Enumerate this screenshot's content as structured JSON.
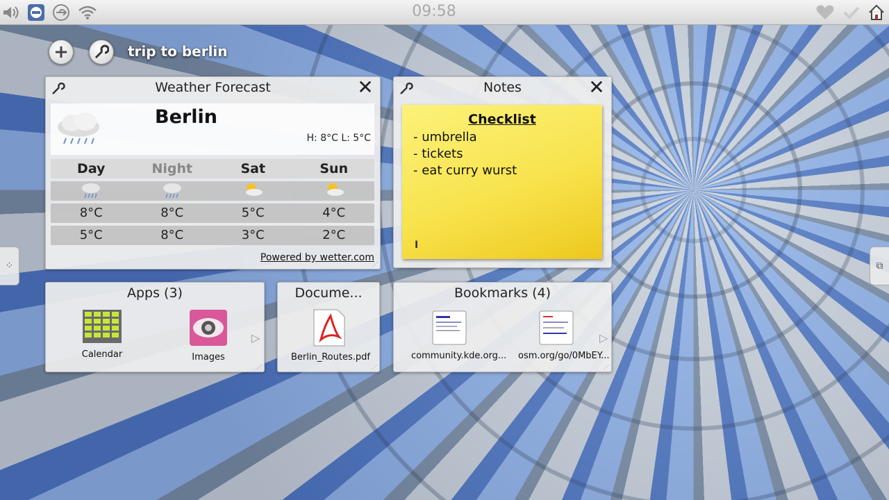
{
  "statusbar": {
    "clock": "09:58",
    "left_icons": [
      "speaker-icon",
      "network-manager-icon",
      "usb-icon",
      "wifi-icon"
    ],
    "right_icons": [
      "heart-icon",
      "check-icon",
      "home-icon"
    ]
  },
  "activity": {
    "title": "trip to berlin"
  },
  "weather": {
    "title": "Weather Forecast",
    "city": "Berlin",
    "high_low": "H: 8°C L: 5°C",
    "days": [
      "Day",
      "Night",
      "Sat",
      "Sun"
    ],
    "conditions": [
      "rain",
      "rain",
      "sun-cloud",
      "sun-cloud"
    ],
    "row1": [
      "8°C",
      "8°C",
      "5°C",
      "4°C"
    ],
    "row2": [
      "5°C",
      "8°C",
      "3°C",
      "2°C"
    ],
    "powered_by": "Powered by wetter.com"
  },
  "notes": {
    "title": "Notes",
    "heading": "Checklist",
    "lines": [
      "- umbrella",
      "- tickets",
      "- eat curry wurst"
    ]
  },
  "apps": {
    "title": "Apps (3)",
    "items": [
      {
        "label": "Calendar",
        "icon": "calendar-icon"
      },
      {
        "label": "Images",
        "icon": "images-icon"
      }
    ]
  },
  "documents": {
    "title": "Docume...",
    "items": [
      {
        "label": "Berlin_Routes.pdf",
        "icon": "pdf-icon"
      }
    ]
  },
  "bookmarks": {
    "title": "Bookmarks (4)",
    "items": [
      {
        "label": "community.kde.org...",
        "icon": "webpage-thumbnail-icon"
      },
      {
        "label": "osm.org/go/0MbEY...",
        "icon": "webpage-thumbnail-icon"
      }
    ]
  },
  "colors": {
    "sticky": "#f8e34d",
    "panel": "#eeeeee"
  }
}
